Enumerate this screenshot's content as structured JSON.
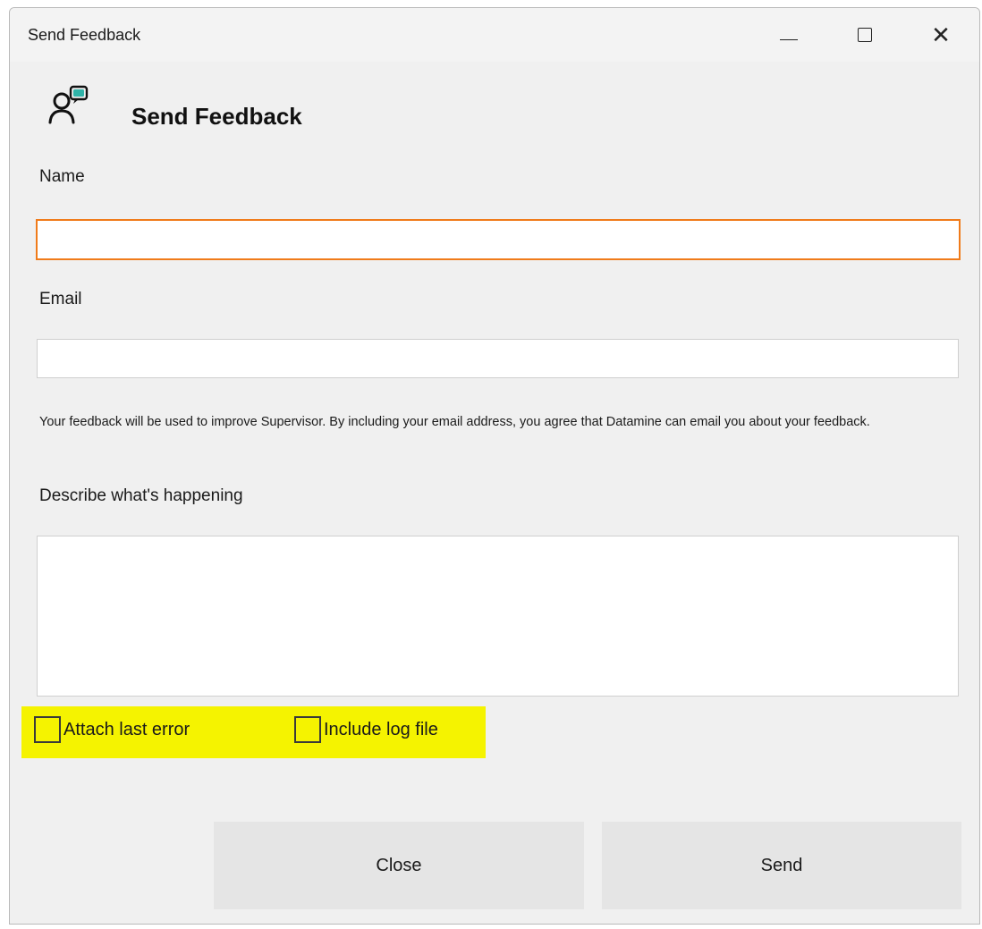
{
  "window": {
    "title": "Send Feedback"
  },
  "icons": {
    "header": "feedback-person-icon",
    "minimize": "minimize-icon",
    "maximize": "maximize-icon",
    "close": "close-icon",
    "close_glyph": "✕"
  },
  "header": {
    "title": "Send Feedback"
  },
  "form": {
    "name_label": "Name",
    "name_value": "",
    "email_label": "Email",
    "email_value": "",
    "notice": "Your feedback will be used to improve Supervisor. By including your email address, you agree that Datamine can email you about your feedback.",
    "describe_label": "Describe what's happening",
    "describe_value": ""
  },
  "options": {
    "attach_last_error": {
      "label": "Attach last error",
      "checked": false
    },
    "include_log_file": {
      "label": "Include log file",
      "checked": false
    }
  },
  "buttons": {
    "close": "Close",
    "send": "Send"
  },
  "colors": {
    "accent_focus": "#f07b1a",
    "highlight": "#f5f300",
    "icon_bubble": "#2fb3a8",
    "window_bg": "#f0f0f0",
    "button_bg": "#e5e5e5"
  }
}
